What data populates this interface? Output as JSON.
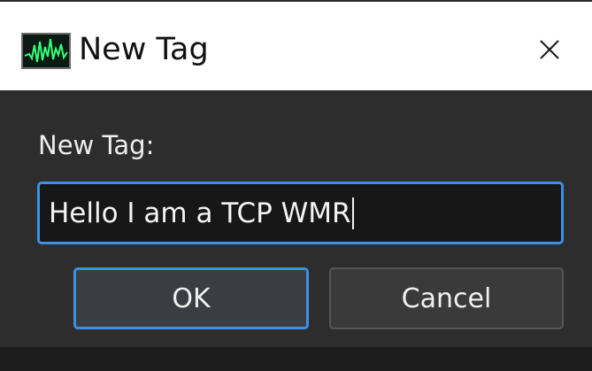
{
  "window": {
    "title": "New Tag",
    "close_icon": "close-icon",
    "app_icon": "waveform-icon"
  },
  "form": {
    "label": "New Tag:",
    "input_value": "Hello I am a TCP WMR"
  },
  "buttons": {
    "ok_label": "OK",
    "cancel_label": "Cancel"
  },
  "colors": {
    "accent": "#3e8fe6",
    "dialog_background": "#2d2d2d",
    "input_background": "#171717",
    "titlebar_background": "#ffffff"
  }
}
